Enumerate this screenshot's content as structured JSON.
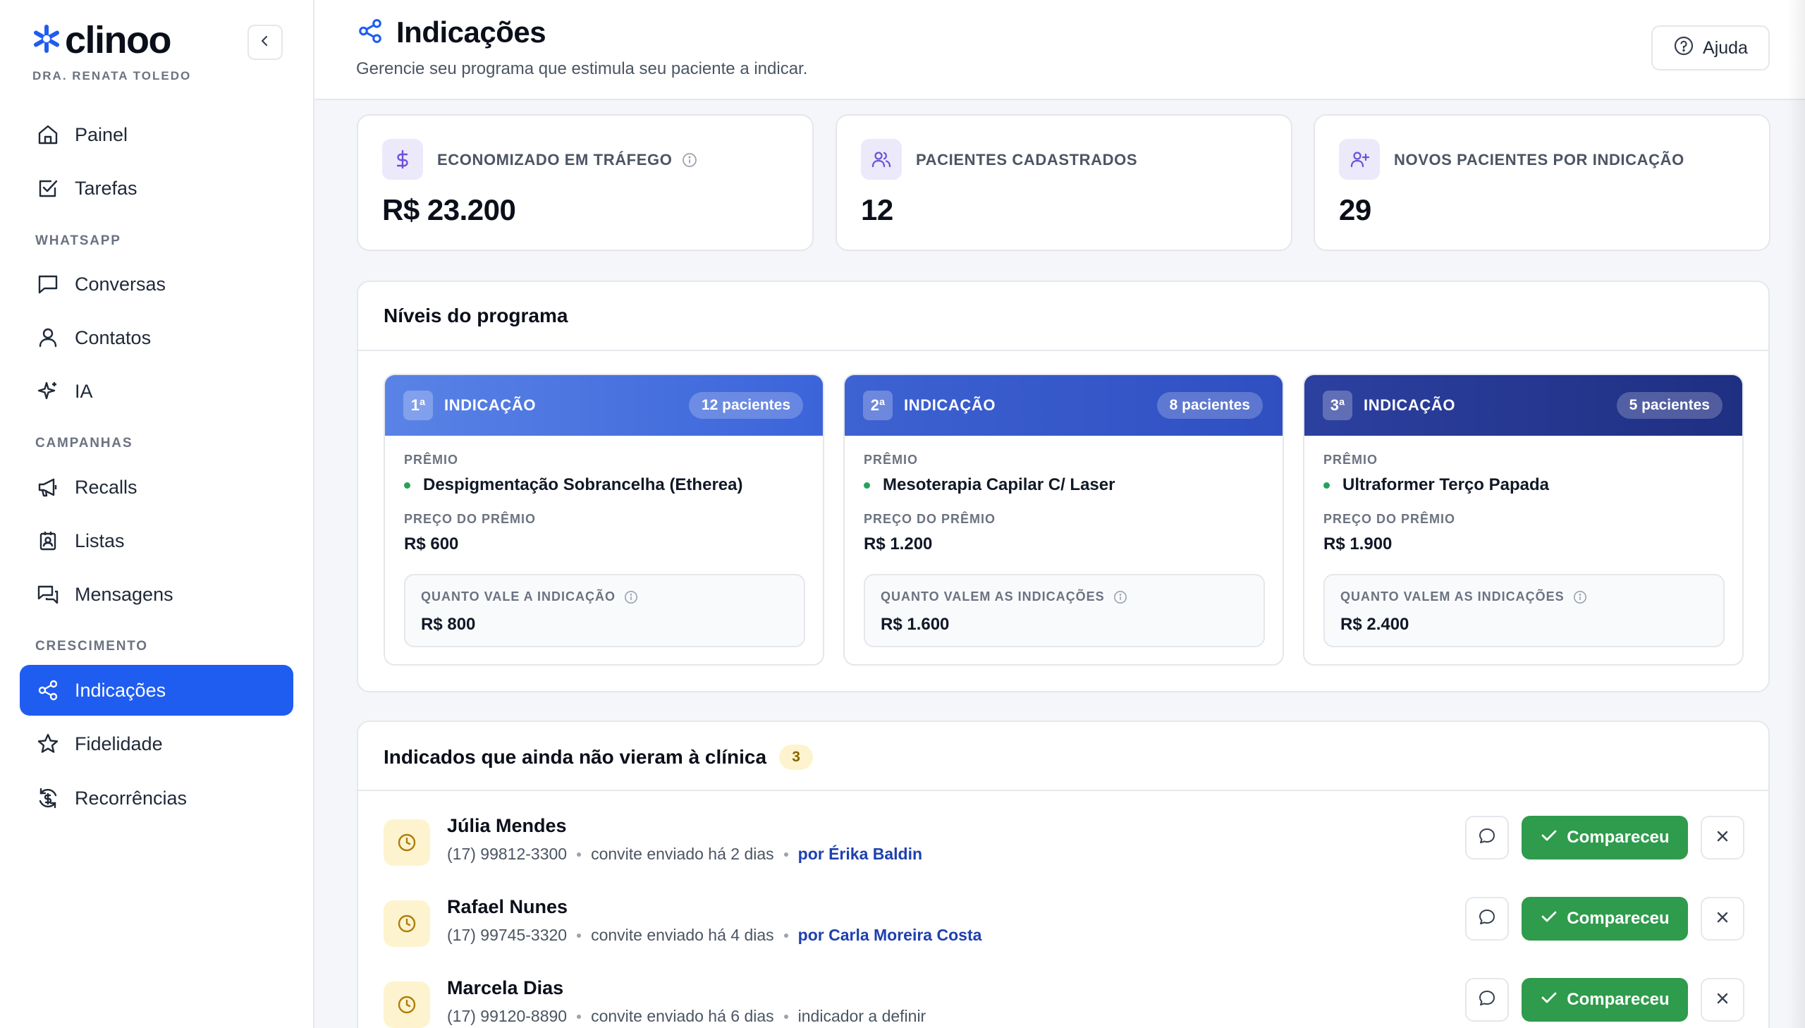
{
  "brand": {
    "name": "clinoo",
    "clinic": "DRA. RENATA TOLEDO"
  },
  "sidebar": {
    "items": [
      {
        "label": "Painel"
      },
      {
        "label": "Tarefas"
      },
      {
        "section": "WHATSAPP"
      },
      {
        "label": "Conversas"
      },
      {
        "label": "Contatos"
      },
      {
        "label": "IA"
      },
      {
        "section": "CAMPANHAS"
      },
      {
        "label": "Recalls"
      },
      {
        "label": "Listas"
      },
      {
        "label": "Mensagens"
      },
      {
        "section": "CRESCIMENTO"
      },
      {
        "label": "Indicações",
        "active": true
      },
      {
        "label": "Fidelidade"
      },
      {
        "label": "Recorrências"
      }
    ]
  },
  "header": {
    "title": "Indicações",
    "subtitle": "Gerencie seu programa que estimula seu paciente a indicar.",
    "help_label": "Ajuda"
  },
  "stats": [
    {
      "label": "ECONOMIZADO EM TRÁFEGO",
      "value": "R$ 23.200",
      "icon": "dollar-icon"
    },
    {
      "label": "PACIENTES CADASTRADOS",
      "value": "12",
      "icon": "users-icon"
    },
    {
      "label": "NOVOS PACIENTES POR INDICAÇÃO",
      "value": "29",
      "icon": "user-plus-icon"
    }
  ],
  "levels": {
    "title": "Níveis do programa",
    "prize_label": "PRÊMIO",
    "price_label": "PREÇO DO PRÊMIO",
    "items": [
      {
        "ordinal": "1ª",
        "title": "INDICAÇÃO",
        "badge": "12 pacientes",
        "prize": "Despigmentação Sobrancelha (Etherea)",
        "price": "R$ 600",
        "worth_label": "QUANTO VALE A INDICAÇÃO",
        "worth": "R$ 800",
        "color_from": "#4f7be0",
        "color_to": "#3a64d8"
      },
      {
        "ordinal": "2ª",
        "title": "INDICAÇÃO",
        "badge": "8 pacientes",
        "prize": "Mesoterapia Capilar C/ Laser",
        "price": "R$ 1.200",
        "worth_label": "QUANTO VALEM AS INDICAÇÕES",
        "worth": "R$ 1.600",
        "color_from": "#3a5fcf",
        "color_to": "#2f4fc0"
      },
      {
        "ordinal": "3ª",
        "title": "INDICAÇÃO",
        "badge": "5 pacientes",
        "prize": "Ultraformer Terço Papada",
        "price": "R$ 1.900",
        "worth_label": "QUANTO VALEM AS INDICAÇÕES",
        "worth": "R$ 2.400",
        "color_from": "#2b3f9e",
        "color_to": "#1f2f80"
      }
    ]
  },
  "pending": {
    "title": "Indicados que ainda não vieram à clínica",
    "count": "3",
    "attend_label": "Compareceu",
    "rows": [
      {
        "name": "Júlia Mendes",
        "phone": "(17) 99812-3300",
        "sent": "convite enviado há 2 dias",
        "by": "por Érika Baldin"
      },
      {
        "name": "Rafael Nunes",
        "phone": "(17) 99745-3320",
        "sent": "convite enviado há 4 dias",
        "by": "por Carla Moreira Costa"
      },
      {
        "name": "Marcela Dias",
        "phone": "(17) 99120-8890",
        "sent": "convite enviado há 6 dias",
        "by_plain": "indicador a definir"
      }
    ]
  },
  "colors": {
    "accent": "#1f5cf0",
    "success": "#2f9b4c",
    "pending_bg": "#fdf4cf"
  }
}
